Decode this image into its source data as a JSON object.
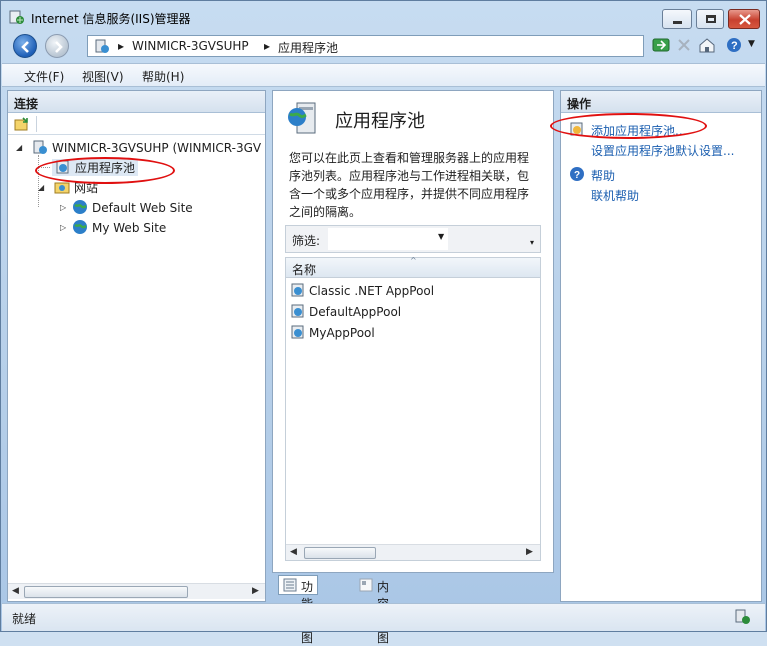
{
  "window": {
    "title": "Internet 信息服务(IIS)管理器"
  },
  "address": {
    "crumbs": [
      "WINMICR-3GVSUHP",
      "应用程序池"
    ]
  },
  "menu": {
    "items": [
      "文件(F)",
      "视图(V)",
      "帮助(H)"
    ]
  },
  "connections": {
    "header": "连接",
    "tree": {
      "server": "WINMICR-3GVSUHP (WINMICR-3GV",
      "app_pools": "应用程序池",
      "sites": "网站",
      "site1": "Default Web Site",
      "site2": "My Web Site"
    }
  },
  "center": {
    "title": "应用程序池",
    "description": "您可以在此页上查看和管理服务器上的应用程序池列表。应用程序池与工作进程相关联，包含一个或多个应用程序，并提供不同应用程序之间的隔离。",
    "filter_label": "筛选:",
    "column_name": "名称",
    "pools": [
      "Classic .NET AppPool",
      "DefaultAppPool",
      "MyAppPool"
    ],
    "view_features": "功能视图",
    "view_content": "内容视图"
  },
  "actions": {
    "header": "操作",
    "add_pool": "添加应用程序池...",
    "set_defaults": "设置应用程序池默认设置...",
    "help": "帮助",
    "online_help": "联机帮助"
  },
  "status": {
    "text": "就绪"
  },
  "colors": {
    "link": "#1c5fb0",
    "annotation": "#e01010"
  }
}
